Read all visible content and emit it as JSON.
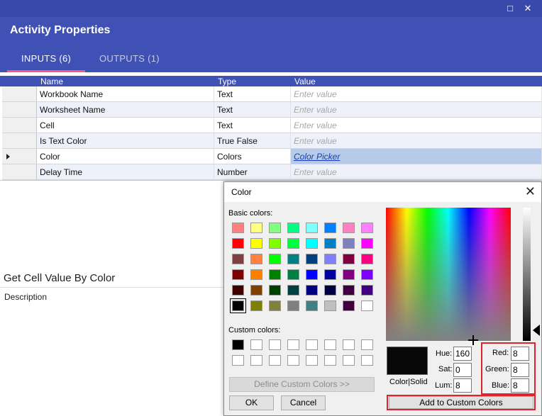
{
  "window": {
    "title": "Activity Properties",
    "maximize_icon": "□",
    "close_icon": "✕"
  },
  "tabs": [
    {
      "label": "INPUTS (6)",
      "active": true
    },
    {
      "label": "OUTPUTS (1)",
      "active": false
    }
  ],
  "grid": {
    "columns": [
      "Name",
      "Type",
      "Value"
    ],
    "rows": [
      {
        "name": "Workbook Name",
        "type": "Text",
        "value": "Enter value"
      },
      {
        "name": "Worksheet Name",
        "type": "Text",
        "value": "Enter value"
      },
      {
        "name": "Cell",
        "type": "Text",
        "value": "Enter value"
      },
      {
        "name": "Is Text Color",
        "type": "True False",
        "value": "Enter value"
      },
      {
        "name": "Color",
        "type": "Colors",
        "value": "Color Picker",
        "current": true
      },
      {
        "name": "Delay Time",
        "type": "Number",
        "value": "Enter value"
      }
    ]
  },
  "info": {
    "activity_title": "Get Cell Value By Color",
    "description_label": "Description"
  },
  "color_dialog": {
    "title": "Color",
    "close_icon": "✕",
    "basic_colors_label": "Basic colors:",
    "custom_colors_label": "Custom colors:",
    "basic_colors": [
      [
        "#ff8080",
        "#ffff80",
        "#80ff80",
        "#00ff80",
        "#80ffff",
        "#0080ff",
        "#ff80c0",
        "#ff80ff"
      ],
      [
        "#ff0000",
        "#ffff00",
        "#80ff00",
        "#00ff40",
        "#00ffff",
        "#0080c0",
        "#8080c0",
        "#ff00ff"
      ],
      [
        "#804040",
        "#ff8040",
        "#00ff00",
        "#008080",
        "#004080",
        "#8080ff",
        "#800040",
        "#ff0080"
      ],
      [
        "#800000",
        "#ff8000",
        "#008000",
        "#008040",
        "#0000ff",
        "#0000a0",
        "#800080",
        "#8000ff"
      ],
      [
        "#400000",
        "#804000",
        "#004000",
        "#004040",
        "#000080",
        "#000040",
        "#400040",
        "#400080"
      ],
      [
        "#000000",
        "#808000",
        "#808040",
        "#808080",
        "#408080",
        "#c0c0c0",
        "#400040",
        "#ffffff"
      ]
    ],
    "selected_basic": "#000000",
    "custom_colors": [
      [
        "#000000",
        "#ffffff",
        "#ffffff",
        "#ffffff",
        "#ffffff",
        "#ffffff",
        "#ffffff",
        "#ffffff"
      ],
      [
        "#ffffff",
        "#ffffff",
        "#ffffff",
        "#ffffff",
        "#ffffff",
        "#ffffff",
        "#ffffff",
        "#ffffff"
      ]
    ],
    "define_button": "Define Custom Colors >>",
    "ok_button": "OK",
    "cancel_button": "Cancel",
    "color_solid_label": "Color|Solid",
    "hue_label": "Hue:",
    "hue": "160",
    "sat_label": "Sat:",
    "sat": "0",
    "lum_label": "Lum:",
    "lum": "8",
    "red_label": "Red:",
    "red": "8",
    "green_label": "Green:",
    "green": "8",
    "blue_label": "Blue:",
    "blue": "8",
    "add_custom_button": "Add to Custom Colors",
    "preview_color": "#080808",
    "highlight_color": "#e0242e"
  },
  "colors": {
    "header_bg": "#3f51b5",
    "tab_indicator": "#ef5b8a",
    "current_row_bg": "#b7cbe8"
  }
}
